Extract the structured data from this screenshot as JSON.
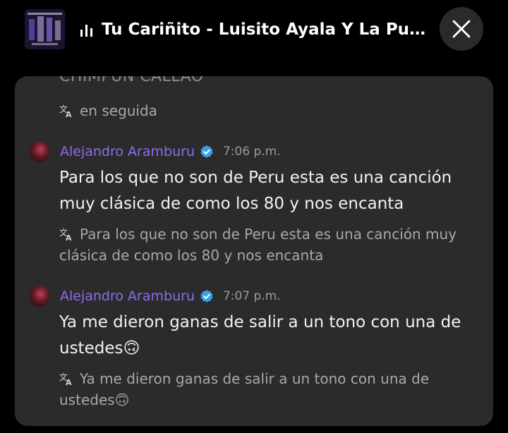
{
  "header": {
    "song_title": "Tu Cariñito - Luisito Ayala Y La Puerto Ri...",
    "eq_icon": "equalizer-icon",
    "close_icon": "close-icon"
  },
  "chat": {
    "cut_top_text": "CHIMPUN CALLAO",
    "first_translation": "en seguida",
    "messages": [
      {
        "author": "Alejandro Aramburu",
        "time": "7:06 p.m.",
        "text": "Para los que no son de Peru esta es una canción muy clásica de como los 80 y nos encanta",
        "translation": "Para los que no son de Peru esta es una canción muy clásica de como los 80 y nos encanta"
      },
      {
        "author": "Alejandro Aramburu",
        "time": "7:07 p.m.",
        "text": "Ya me dieron ganas de salir a un tono con una de ustedes🙃",
        "translation": "Ya me dieron ganas de salir a un tono con una de ustedes🙃"
      }
    ]
  },
  "colors": {
    "background": "#000000",
    "panel": "#2b2b2b",
    "author": "#8f6cf0",
    "verified": "#3aa0e8",
    "muted": "#a8a8a8"
  }
}
